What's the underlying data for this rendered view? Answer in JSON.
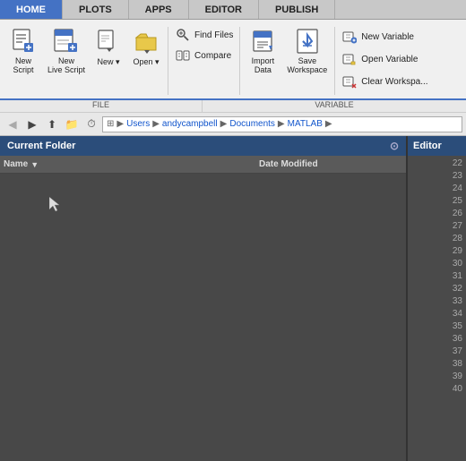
{
  "tabs": [
    {
      "id": "home",
      "label": "HOME",
      "active": true
    },
    {
      "id": "plots",
      "label": "PLOTS",
      "active": false
    },
    {
      "id": "apps",
      "label": "APPS",
      "active": false
    },
    {
      "id": "editor",
      "label": "EDITOR",
      "active": false
    },
    {
      "id": "publish",
      "label": "PUBLISH",
      "active": false
    }
  ],
  "ribbon": {
    "file_group_label": "FILE",
    "variable_group_label": "VARIABLE",
    "buttons": {
      "new_script": "New\nScript",
      "new_live_script": "New\nLive Script",
      "new": "New",
      "open": "Open",
      "find_files": "Find Files",
      "compare": "Compare",
      "import_data": "Import\nData",
      "save_workspace": "Save\nWorkspace",
      "new_variable": "New Variable",
      "open_variable": "Open Variable",
      "clear_workspace": "Clear Workspa..."
    }
  },
  "toolbar": {
    "back": "◀",
    "forward": "▶",
    "path_parts": [
      "",
      "Users",
      "andycampbell",
      "Documents",
      "MATLAB"
    ]
  },
  "folder_panel": {
    "title": "Current Folder",
    "col_name": "Name",
    "col_sort": "▼",
    "col_date": "Date Modified"
  },
  "editor_panel": {
    "title": "Editor",
    "line_numbers": [
      "22",
      "23",
      "24",
      "25",
      "26",
      "27",
      "28",
      "29",
      "30",
      "31",
      "32",
      "33",
      "34",
      "35",
      "36",
      "37",
      "38",
      "39",
      "40"
    ]
  }
}
